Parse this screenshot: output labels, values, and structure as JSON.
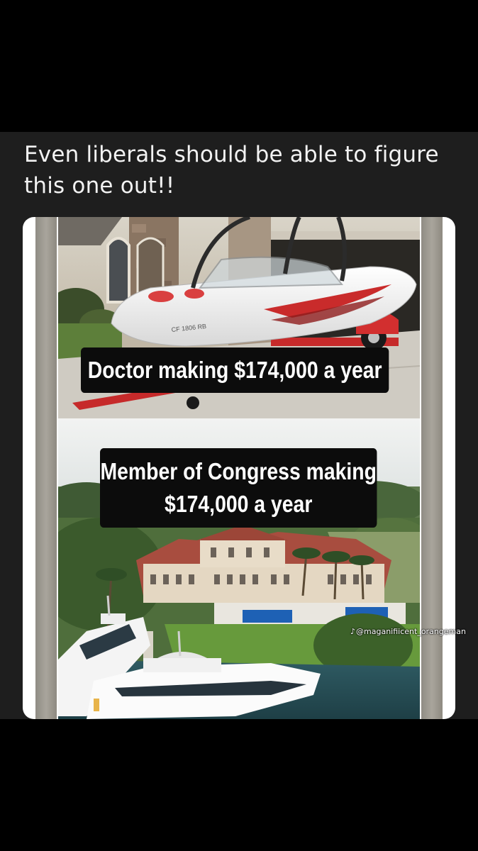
{
  "post": {
    "caption": "Even liberals should be able to figure this one out!!"
  },
  "meme": {
    "top_label": "Doctor making $174,000 a year",
    "bottom_label_line1": "Member of Congress making",
    "bottom_label_line2": "$174,000 a year",
    "watermark_icon": "tiktok-icon",
    "watermark_text": "@maganifiicent_orangeman",
    "boat_hull_text": "CF 1806 RB"
  },
  "colors": {
    "page_background": "#000000",
    "post_background": "#1e1e1e",
    "caption_text": "#f2f2f2",
    "label_background": "#0c0c0c",
    "label_text": "#ffffff"
  }
}
